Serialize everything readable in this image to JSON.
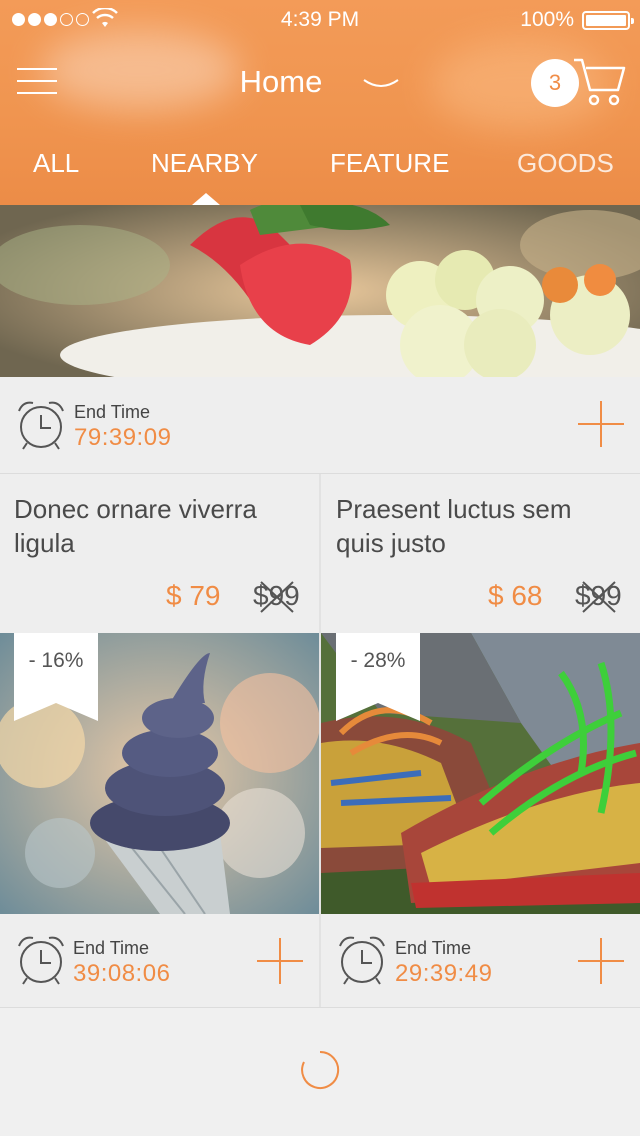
{
  "status_bar": {
    "time": "4:39 PM",
    "battery": "100%",
    "signal_bars": 3
  },
  "nav": {
    "title": "Home",
    "cart_count": "3"
  },
  "tabs": [
    {
      "label": "ALL"
    },
    {
      "label": "NEARBY",
      "active": true
    },
    {
      "label": "FEATURE"
    },
    {
      "label": "GOODS"
    }
  ],
  "featured": {
    "end_label": "End Time",
    "end_time": "79:39:09"
  },
  "products": [
    {
      "name": "Donec ornare viverra ligula",
      "price": "$ 79",
      "old_price": "$99",
      "discount": "- 16%",
      "end_label": "End Time",
      "end_time": "39:08:06"
    },
    {
      "name": "Praesent luctus sem quis justo",
      "price": "$ 68",
      "old_price": "$99",
      "discount": "- 28%",
      "end_label": "End Time",
      "end_time": "29:39:49"
    }
  ],
  "colors": {
    "accent": "#f08c45",
    "header": "#f09550",
    "background": "#eeeeee"
  }
}
